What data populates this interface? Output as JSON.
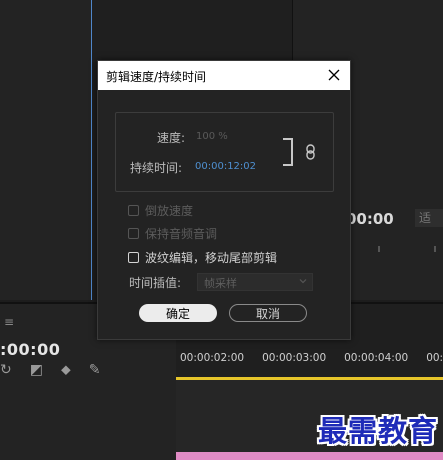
{
  "dialog": {
    "title": "剪辑速度/持续时间",
    "speed_label": "速度:",
    "speed_value": "100 %",
    "duration_label": "持续时间:",
    "duration_value": "00:00:12:02",
    "reverse_label": "倒放速度",
    "maintain_audio_label": "保持音频音调",
    "ripple_label": "波纹编辑，移动尾部剪辑",
    "interp_label": "时间插值:",
    "interp_value": "帧采样",
    "ok_label": "确定",
    "cancel_label": "取消"
  },
  "background": {
    "right_timecode": "00:00",
    "right_dropdown": "适",
    "timeline_menu": "≡",
    "timeline_timecode": ":00:00",
    "ruler_ticks": [
      "00:00:02:00",
      "00:00:03:00",
      "00:00:04:00",
      "00:00"
    ]
  },
  "watermark": "最需教育",
  "colors": {
    "accent_blue": "#4e8fd0",
    "playhead_yellow": "#e6c52a",
    "clip_pink": "#e18cc5"
  }
}
